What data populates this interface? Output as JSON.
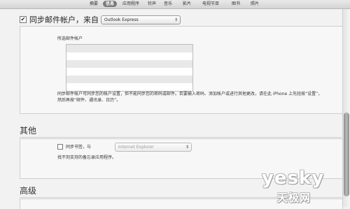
{
  "tabs": [
    {
      "label": "摘要"
    },
    {
      "label": "信息",
      "active": true
    },
    {
      "label": "应用程序"
    },
    {
      "label": "铃声"
    },
    {
      "label": "音乐"
    },
    {
      "label": "影片"
    },
    {
      "label": "电视节目"
    },
    {
      "label": "图书"
    },
    {
      "label": "照片"
    }
  ],
  "mail": {
    "sync_checked": true,
    "title": "同步邮件帐户，来自",
    "source_value": "Outlook Express",
    "selected_accounts_label": "所选邮件帐户",
    "description": "同步邮件帐户可同步您的帐户设置，但不能同步您的密码或邮件。若要输入密码、添加帐户或进行其他更改，请在此 iPhone 上先轻按“设置”，然后再按“邮件、通讯录、日历”。"
  },
  "other": {
    "title": "其他",
    "bookmarks_checked": false,
    "bookmarks_label": "同步书签，与",
    "browser_value": "Internet Explorer",
    "unsupported_note": "找不到支持的备忘录应用程序。"
  },
  "advanced": {
    "title": "高级"
  },
  "watermark": {
    "top": "yesky",
    "bottom": "天极网"
  },
  "colors": {
    "active_tab": "#7a7a7a",
    "background": "#f2f2f2",
    "panel": "#f7f7f7"
  }
}
